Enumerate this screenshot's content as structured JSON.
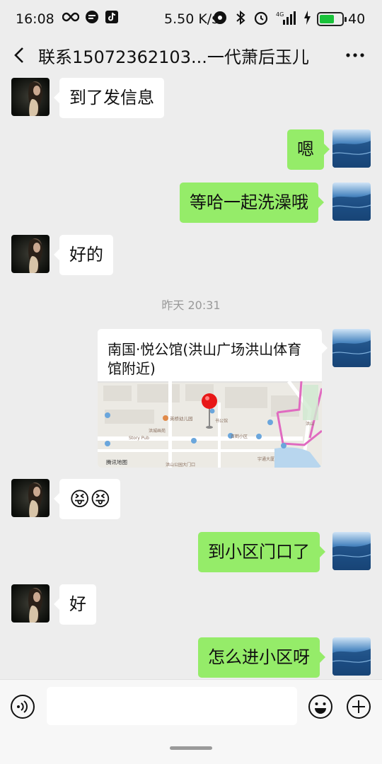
{
  "status_bar": {
    "time": "16:08",
    "network_speed": "5.50 K/s",
    "network_type": "4G",
    "battery_level": "40",
    "icons": [
      "infinity-icon",
      "message-icon",
      "tiktok-icon",
      "hotspot-icon",
      "bluetooth-icon",
      "alarm-icon",
      "signal-icon",
      "charging-icon",
      "battery-icon"
    ]
  },
  "header": {
    "title": "联系15072362103...一代萧后玉儿",
    "back_icon": "chevron-left-icon",
    "more_icon": "more-dots-icon"
  },
  "messages": [
    {
      "side": "in",
      "text": "到了发信息"
    },
    {
      "side": "out",
      "text": "嗯"
    },
    {
      "side": "out",
      "text": "等哈一起洗澡哦"
    },
    {
      "side": "in",
      "text": "好的"
    },
    {
      "side": "out",
      "type": "location",
      "text": "南国·悦公馆(洪山广场洪山体育馆附近)"
    },
    {
      "side": "in",
      "text": "😝😝"
    },
    {
      "side": "out",
      "text": "到小区门口了"
    },
    {
      "side": "in",
      "text": "好"
    },
    {
      "side": "out",
      "text": "怎么进小区呀"
    }
  ],
  "timestamp": "昨天 20:31",
  "map_labels": {
    "label_1": "英桥幼儿园",
    "label_2": "洪城画苑",
    "label_3": "Story Pub",
    "label_4": "腾讯地图",
    "label_5": "宇通大厦",
    "label_6": "洪山公园大门口",
    "label_7": "百鹤小区",
    "label_8": "洪山",
    "label_9": "书公馆"
  },
  "input_bar": {
    "voice_icon": "voice-icon",
    "emoji_icon": "emoji-icon",
    "plus_icon": "plus-icon"
  },
  "colors": {
    "background": "#ededed",
    "outgoing_bubble": "#95ec69",
    "incoming_bubble": "#ffffff"
  }
}
